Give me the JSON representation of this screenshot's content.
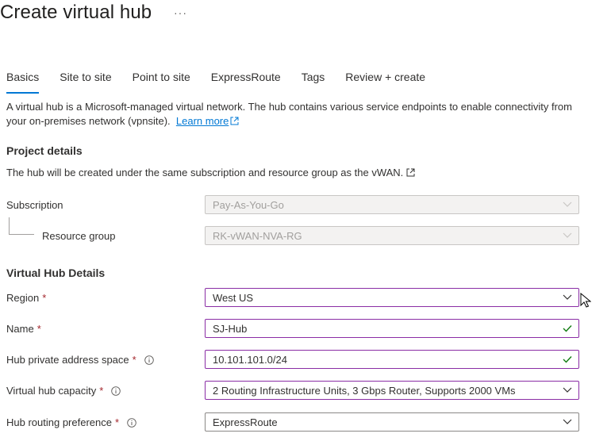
{
  "header": {
    "title": "Create virtual hub",
    "more_label": "···"
  },
  "tabs": [
    {
      "label": "Basics",
      "active": true
    },
    {
      "label": "Site to site",
      "active": false
    },
    {
      "label": "Point to site",
      "active": false
    },
    {
      "label": "ExpressRoute",
      "active": false
    },
    {
      "label": "Tags",
      "active": false
    },
    {
      "label": "Review + create",
      "active": false
    }
  ],
  "intro": {
    "text": "A virtual hub is a Microsoft-managed virtual network. The hub contains various service endpoints to enable connectivity from your on-premises network (vpnsite).",
    "link_label": "Learn more"
  },
  "project_details": {
    "title": "Project details",
    "description": "The hub will be created under the same subscription and resource group as the vWAN.",
    "subscription_label": "Subscription",
    "subscription_value": "Pay-As-You-Go",
    "resource_group_label": "Resource group",
    "resource_group_value": "RK-vWAN-NVA-RG"
  },
  "hub_details": {
    "title": "Virtual Hub Details",
    "required_marker": "*",
    "region_label": "Region",
    "region_value": "West US",
    "name_label": "Name",
    "name_value": "SJ-Hub",
    "address_space_label": "Hub private address space",
    "address_space_value": "10.101.101.0/24",
    "capacity_label": "Virtual hub capacity",
    "capacity_value": "2 Routing Infrastructure Units, 3 Gbps Router, Supports 2000 VMs",
    "routing_pref_label": "Hub routing preference",
    "routing_pref_value": "ExpressRoute"
  },
  "colors": {
    "accent": "#0078d4",
    "required": "#a4262c",
    "valid_check": "#107c10",
    "focused_border": "#8a2da5"
  }
}
